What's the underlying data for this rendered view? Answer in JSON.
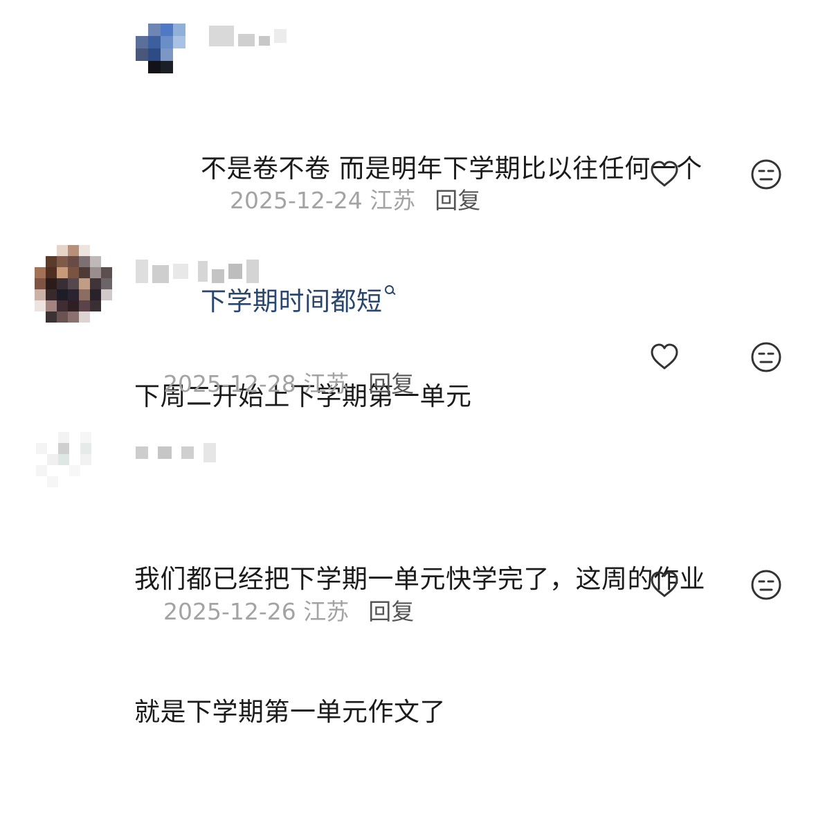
{
  "comments": [
    {
      "text_lines": [
        "不是卷不卷 而是明年下学期比以往任何一个"
      ],
      "link_text": "下学期时间都短",
      "date": "2025-12-24",
      "location": "江苏",
      "reply_label": "回复",
      "like_icon": "heart-icon",
      "reaction_icon": "emoji-icon"
    },
    {
      "text_lines": [
        "下周二开始上下学期第一单元"
      ],
      "date": "2025-12-28",
      "location": "江苏",
      "reply_label": "回复",
      "like_icon": "heart-icon",
      "reaction_icon": "emoji-icon"
    },
    {
      "text_lines": [
        "我们都已经把下学期一单元快学完了，这周的作业",
        "就是下学期第一单元作文了"
      ],
      "date": "2025-12-26",
      "location": "江苏",
      "reply_label": "回复",
      "like_icon": "heart-icon",
      "reaction_icon": "emoji-icon"
    }
  ],
  "colors": {
    "link": "#28466e",
    "meta": "#a3a3a3",
    "reply": "#555555",
    "icon_stroke": "#333333"
  }
}
